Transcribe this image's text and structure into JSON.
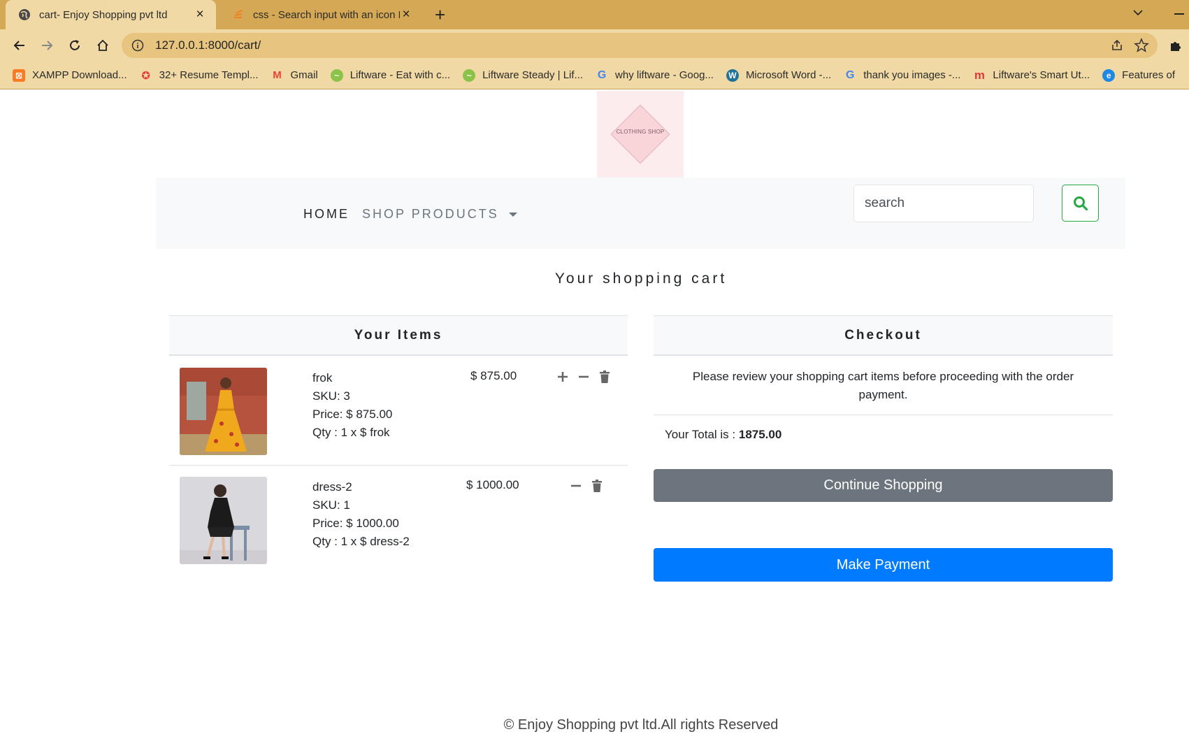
{
  "browser": {
    "tabs": [
      {
        "title": "cart- Enjoy Shopping pvt ltd",
        "active": true
      },
      {
        "title": "css - Search input with an icon Bo",
        "active": false
      }
    ],
    "url": "127.0.0.1:8000/cart/",
    "bookmarks": [
      {
        "label": "XAMPP Download...",
        "icon": "xampp-icon",
        "color": "#fb7a24"
      },
      {
        "label": "32+ Resume Templ...",
        "icon": "resume-icon",
        "color": "#e53935"
      },
      {
        "label": "Gmail",
        "icon": "gmail-icon",
        "color": "#ea4335"
      },
      {
        "label": "Liftware - Eat with c...",
        "icon": "liftware-icon",
        "color": "#8bc34a"
      },
      {
        "label": "Liftware Steady | Lif...",
        "icon": "liftware-icon",
        "color": "#8bc34a"
      },
      {
        "label": "why liftware - Goog...",
        "icon": "google-icon",
        "color": "#4285f4"
      },
      {
        "label": "Microsoft Word -...",
        "icon": "wordpress-icon",
        "color": "#21759b"
      },
      {
        "label": "thank you images -...",
        "icon": "google-icon",
        "color": "#4285f4"
      },
      {
        "label": "Liftware's Smart Ut...",
        "icon": "m-icon",
        "color": "#e53935"
      },
      {
        "label": "Features of",
        "icon": "edge-icon",
        "color": "#1e88e5"
      }
    ]
  },
  "logo": {
    "text": "CLOTHING SHOP"
  },
  "nav": {
    "home": "HOME",
    "shop": "SHOP PRODUCTS"
  },
  "search": {
    "placeholder": "search"
  },
  "cart": {
    "title": "Your shopping cart",
    "items_header": "Your Items",
    "checkout_header": "Checkout",
    "items": [
      {
        "name": "frok",
        "sku": "SKU: 3",
        "price": "Price: $ 875.00",
        "qty": "Qty : 1 x $ frok",
        "line_total": "$ 875.00"
      },
      {
        "name": "dress-2",
        "sku": "SKU: 1",
        "price": "Price: $ 1000.00",
        "qty": "Qty : 1 x $ dress-2",
        "line_total": "$ 1000.00"
      }
    ],
    "review_text": "Please review your shopping cart items before proceeding with the order payment.",
    "total_label": "Your Total is :",
    "total_value": "1875.00",
    "continue_label": "Continue Shopping",
    "pay_label": "Make Payment"
  },
  "footer": "© Enjoy Shopping pvt ltd.All rights Reserved",
  "colors": {
    "chrome_tabbar": "#d4a854",
    "chrome_toolbar": "#f0d9a4",
    "continue_button": "#6c757d",
    "pay_button": "#007bff",
    "search_button_border": "#28a745"
  }
}
